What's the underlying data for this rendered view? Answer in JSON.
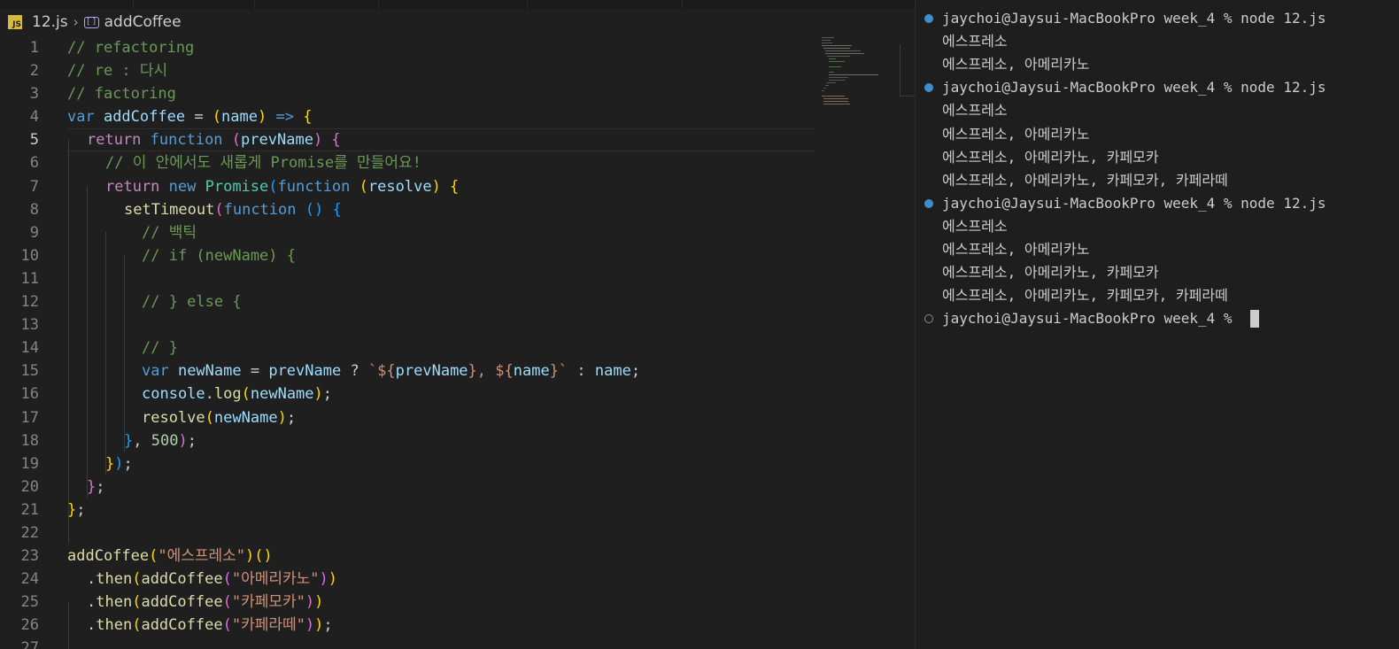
{
  "editor": {
    "breadcrumb": {
      "file": "12.js",
      "symbol": "addCoffee"
    },
    "file_icon": "javascript-file-icon",
    "symbol_icon": "variable-symbol-icon",
    "active_line": 5,
    "lines": [
      {
        "n": "1"
      },
      {
        "n": "2"
      },
      {
        "n": "3"
      },
      {
        "n": "4"
      },
      {
        "n": "5"
      },
      {
        "n": "6"
      },
      {
        "n": "7"
      },
      {
        "n": "8"
      },
      {
        "n": "9"
      },
      {
        "n": "10"
      },
      {
        "n": "11"
      },
      {
        "n": "12"
      },
      {
        "n": "13"
      },
      {
        "n": "14"
      },
      {
        "n": "15"
      },
      {
        "n": "16"
      },
      {
        "n": "17"
      },
      {
        "n": "18"
      },
      {
        "n": "19"
      },
      {
        "n": "20"
      },
      {
        "n": "21"
      },
      {
        "n": "22"
      },
      {
        "n": "23"
      },
      {
        "n": "24"
      },
      {
        "n": "25"
      },
      {
        "n": "26"
      },
      {
        "n": "27"
      }
    ],
    "code": {
      "l1": "// refactoring",
      "l2": "// re : 다시",
      "l3": "// factoring",
      "l4": {
        "kw": "var",
        "name": " addCoffee",
        "eq": " = ",
        "p1": "(",
        "param": "name",
        "p2": ")",
        "arrow": " => ",
        "brace": "{"
      },
      "l5": {
        "kw": "return",
        "fnkw": " function",
        "sp": " ",
        "p1": "(",
        "param": "prevName",
        "p2": ")",
        "brace": " {"
      },
      "l6": "// 이 안에서도 새롭게 Promise를 만들어요!",
      "l7": {
        "kw": "return",
        "newkw": " new",
        "cls": " Promise",
        "p1": "(",
        "fnkw": "function",
        "sp": " ",
        "p2": "(",
        "param": "resolve",
        "p3": ")",
        "brace": " {"
      },
      "l8": {
        "fn": "setTimeout",
        "p1": "(",
        "fnkw": "function",
        "p2": " ()",
        "brace": " {"
      },
      "l9": "// 백틱",
      "l10": "// if (newName) {",
      "l12": "// } else {",
      "l14": "// }",
      "l15": {
        "kw": "var",
        "v1": " newName",
        "eq": " = ",
        "v2": "prevName",
        "q": " ? ",
        "t1": "`${",
        "tv1": "prevName",
        "t2": "}, ${",
        "tv2": "name",
        "t3": "}`",
        "c": " : ",
        "v3": "name",
        "end": ";"
      },
      "l16": {
        "obj": "console",
        "dot": ".",
        "fn": "log",
        "p1": "(",
        "arg": "newName",
        "p2": ")",
        "end": ";"
      },
      "l17": {
        "fn": "resolve",
        "p1": "(",
        "arg": "newName",
        "p2": ")",
        "end": ";"
      },
      "l18": {
        "b": "}",
        "sep": ", ",
        "num": "500",
        "p": ")",
        "end": ";"
      },
      "l19": {
        "b": "}",
        "p": ")",
        "end": ";"
      },
      "l20": {
        "b": "}",
        "end": ";"
      },
      "l21": {
        "b": "}",
        "end": ";"
      },
      "l23": {
        "fn": "addCoffee",
        "p1": "(",
        "str": "\"에스프레소\"",
        "p2": ")",
        "call": "()"
      },
      "l24": {
        "dot": ".",
        "fn": "then",
        "p1": "(",
        "fn2": "addCoffee",
        "p2": "(",
        "str": "\"아메리카노\"",
        "p3": ")",
        "p4": ")"
      },
      "l25": {
        "dot": ".",
        "fn": "then",
        "p1": "(",
        "fn2": "addCoffee",
        "p2": "(",
        "str": "\"카페모카\"",
        "p3": ")",
        "p4": ")"
      },
      "l26": {
        "dot": ".",
        "fn": "then",
        "p1": "(",
        "fn2": "addCoffee",
        "p2": "(",
        "str": "\"카페라떼\"",
        "p3": ")",
        "p4": ")",
        "end": ";"
      }
    }
  },
  "terminal": {
    "lines": [
      {
        "status": "done",
        "text": "jaychoi@Jaysui-MacBookPro week_4 % node 12.js"
      },
      {
        "status": "",
        "text": "에스프레소"
      },
      {
        "status": "",
        "text": "에스프레소, 아메리카노"
      },
      {
        "status": "done",
        "text": "jaychoi@Jaysui-MacBookPro week_4 % node 12.js"
      },
      {
        "status": "",
        "text": "에스프레소"
      },
      {
        "status": "",
        "text": "에스프레소, 아메리카노"
      },
      {
        "status": "",
        "text": "에스프레소, 아메리카노, 카페모카"
      },
      {
        "status": "",
        "text": "에스프레소, 아메리카노, 카페모카, 카페라떼"
      },
      {
        "status": "done",
        "text": "jaychoi@Jaysui-MacBookPro week_4 % node 12.js"
      },
      {
        "status": "",
        "text": "에스프레소"
      },
      {
        "status": "",
        "text": "에스프레소, 아메리카노"
      },
      {
        "status": "",
        "text": "에스프레소, 아메리카노, 카페모카"
      },
      {
        "status": "",
        "text": "에스프레소, 아메리카노, 카페모카, 카페라떼"
      },
      {
        "status": "pending",
        "text": "jaychoi@Jaysui-MacBookPro week_4 % "
      }
    ],
    "colors": {
      "done_dot": "#3b8fd1",
      "pending_dot": "#8a8a8a"
    }
  }
}
